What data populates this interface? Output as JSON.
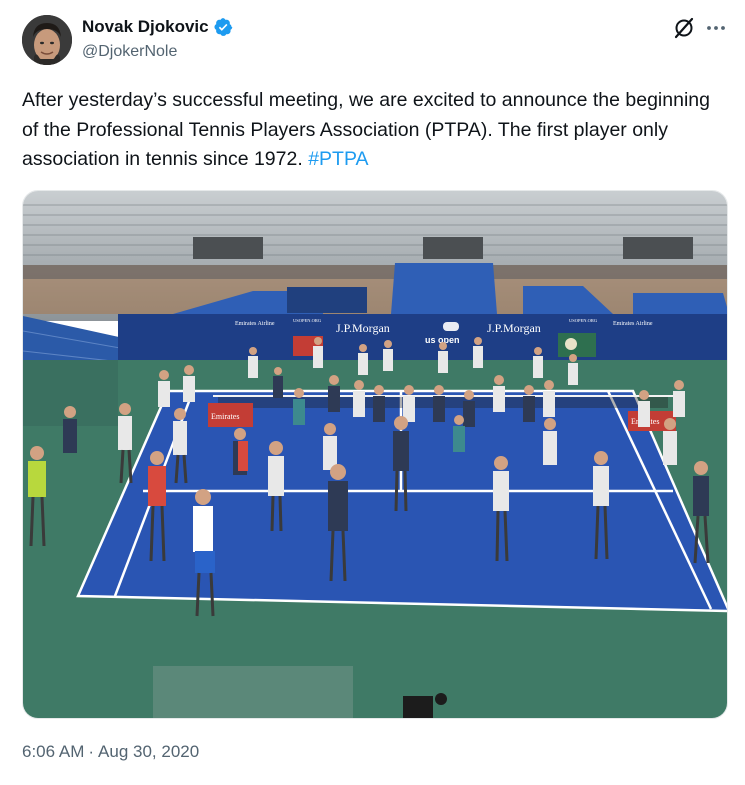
{
  "author": {
    "display_name": "Novak Djokovic",
    "handle": "@DjokerNole",
    "verified": true
  },
  "tweet": {
    "text": "After yesterday’s successful meeting, we are excited to announce the beginning of the Professional Tennis Players Association (PTPA). The first player only association in tennis since 1972. ",
    "hashtag": "#PTPA"
  },
  "photo": {
    "signs": {
      "emirates_left": "Emirates Airline",
      "usopen_small_left": "USOPEN.ORG",
      "jpmorgan_left": "J.P.Morgan",
      "usopen_logo": "us open",
      "jpmorgan_right": "J.P.Morgan",
      "usopen_small_right": "USOPEN.ORG",
      "emirates_right": "Emirates Airline",
      "emirates_board_left": "Emirates",
      "emirates_board_right": "Emirates"
    }
  },
  "meta": {
    "time": "6:06 AM",
    "separator": "·",
    "date": "Aug 30, 2020"
  },
  "icons": {
    "verified": "verified-badge-icon",
    "grok": "grok-icon",
    "more": "more-options-icon"
  },
  "colors": {
    "accent": "#1d9bf0",
    "secondary_text": "#536471",
    "court_blue": "#2a55b3",
    "court_green": "#3f7a66"
  }
}
